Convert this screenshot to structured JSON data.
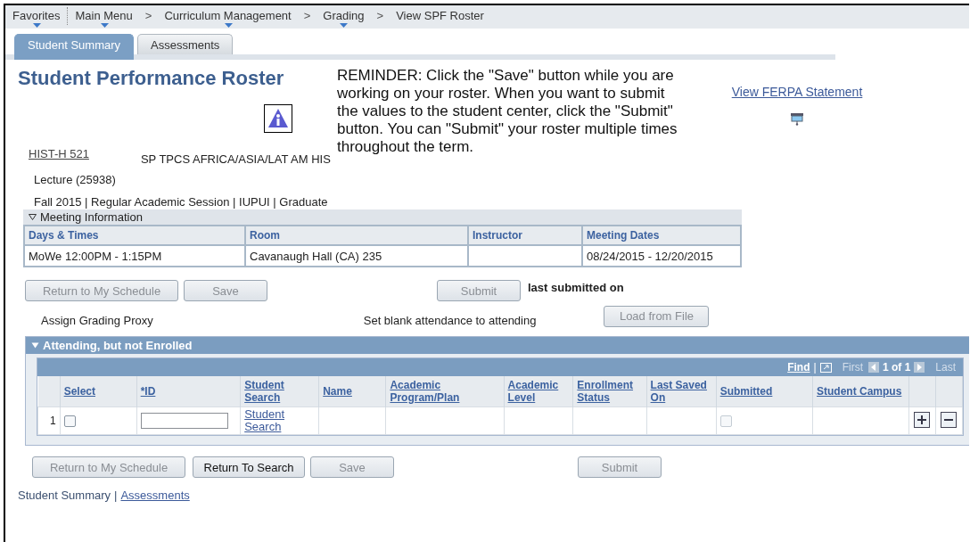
{
  "breadcrumbs": [
    {
      "label": "Favorites",
      "menu": true
    },
    {
      "label": "Main Menu",
      "menu": true
    },
    {
      "label": "Curriculum Management",
      "menu": true,
      "separator": ">"
    },
    {
      "label": "Grading",
      "menu": true,
      "separator": ">"
    },
    {
      "label": "View SPF Roster",
      "menu": false,
      "separator": ">"
    }
  ],
  "tabs": [
    {
      "label": "Student Summary",
      "selected": true
    },
    {
      "label": "Assessments",
      "selected": false
    }
  ],
  "title": "Student Performance Roster",
  "reminder": "REMINDER: Click the \"Save\" button while you are working on your roster. When you want to submit the values to the student center, click the \"Submit\" button. You can \"Submit\" your roster multiple times throughout the term.",
  "ferpa_link": "View FERPA Statement",
  "course": {
    "code": "HIST-H 521",
    "description": "SP TPCS AFRICA/ASIA/LAT AM HIS",
    "component": "Lecture  (25938)",
    "term": "Fall 2015 | Regular Academic Session | IUPUI | Graduate"
  },
  "meeting": {
    "heading": "Meeting Information",
    "expanded": true,
    "columns": [
      "Days & Times",
      "Room",
      "Instructor",
      "Meeting Dates"
    ],
    "rows": [
      [
        "MoWe 12:00PM - 1:15PM",
        "Cavanaugh Hall (CA) 235",
        null,
        "08/24/2015 - 12/20/2015"
      ]
    ]
  },
  "top_buttons": [
    {
      "label": "Return to My Schedule",
      "disabled": true
    },
    {
      "label": "Save",
      "disabled": true
    },
    {
      "label": "Submit",
      "disabled": true
    }
  ],
  "last_submitted": "last submitted on",
  "proxy_link": "Assign Grading Proxy",
  "attendance_link": "Set blank attendance to attending",
  "load_button": {
    "label": "Load from File",
    "disabled": true
  },
  "section": {
    "title": "Attending, but not Enrolled",
    "expanded": true,
    "nav": {
      "find": "Find",
      "separator": "|",
      "first": "First",
      "count": "1 of 1",
      "last": "Last"
    },
    "columns": [
      "Select",
      "*ID",
      "Student Search",
      "Name",
      "Academic Program/Plan",
      "Academic Level",
      "Enrollment Status",
      "Last Saved On",
      "Submitted",
      "Student Campus"
    ],
    "rows": [
      {
        "number": "1",
        "checked": false,
        "search_link": "Student Search",
        "submitted": false
      }
    ]
  },
  "bottom_buttons": [
    {
      "label": "Return to My Schedule",
      "disabled": true
    },
    {
      "label": "Return To Search",
      "disabled": false
    },
    {
      "label": "Save",
      "disabled": true
    },
    {
      "label": "Submit",
      "disabled": true
    }
  ],
  "footer_links": [
    {
      "label": "Student Summary",
      "selected": true
    },
    {
      "label": "Assessments",
      "selected": false,
      "separator": "|"
    }
  ]
}
